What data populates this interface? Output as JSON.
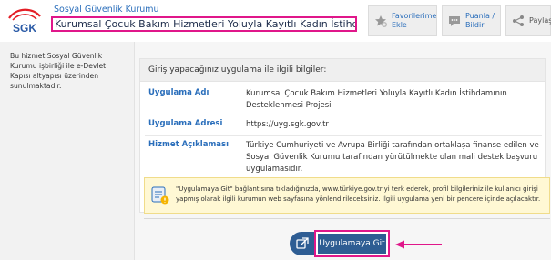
{
  "header": {
    "org_name": "Sosyal Güvenlik Kurumu",
    "service_title": "Kurumsal Çocuk Bakım Hizmetleri Yoluyla Kayıtlı Kadın İstihdamının Destekl...",
    "logo_text": "SGK",
    "buttons": [
      {
        "label": "Favorilerime Ekle",
        "icon": "star-plus-icon"
      },
      {
        "label": "Puanla / Bildir",
        "icon": "comment-icon"
      },
      {
        "label": "Paylaş",
        "icon": "share-icon"
      }
    ]
  },
  "sidebar": {
    "text": "Bu hizmet Sosyal Güvenlik Kurumu işbirliği ile e-Devlet Kapısı altyapısı üzerinden sunulmaktadır."
  },
  "info": {
    "heading": "Giriş yapacağınız uygulama ile ilgili bilgiler:",
    "rows": [
      {
        "label": "Uygulama Adı",
        "value": "Kurumsal Çocuk Bakım Hizmetleri Yoluyla Kayıtlı Kadın İstihdamının Desteklenmesi Projesi"
      },
      {
        "label": "Uygulama Adresi",
        "value": "https://uyg.sgk.gov.tr"
      },
      {
        "label": "Hizmet Açıklaması",
        "value": "Türkiye Cumhuriyeti ve Avrupa Birliği tarafından ortaklaşa finanse edilen ve Sosyal Güvenlik Kurumu tarafından yürütülmekte olan mali destek başvuru uygulamasıdır."
      }
    ]
  },
  "notice": {
    "text": "\"Uygulamaya Git\" bağlantısına tıkladığınızda, www.türkiye.gov.tr'yi terk ederek, profil bilgileriniz ile kullanıcı girişi yapmış olarak ilgili kurumun web sayfasına yönlendirileceksiniz. İlgili uygulama yeni bir pencere içinde açılacaktır.",
    "icon": "warning-hand-icon"
  },
  "action": {
    "go_label": "Uygulamaya Git",
    "icon": "external-app-icon"
  },
  "colors": {
    "accent": "#2a6ebb",
    "button": "#2e5d93",
    "highlight": "#e0178a",
    "notice_bg": "#fff8d4"
  }
}
